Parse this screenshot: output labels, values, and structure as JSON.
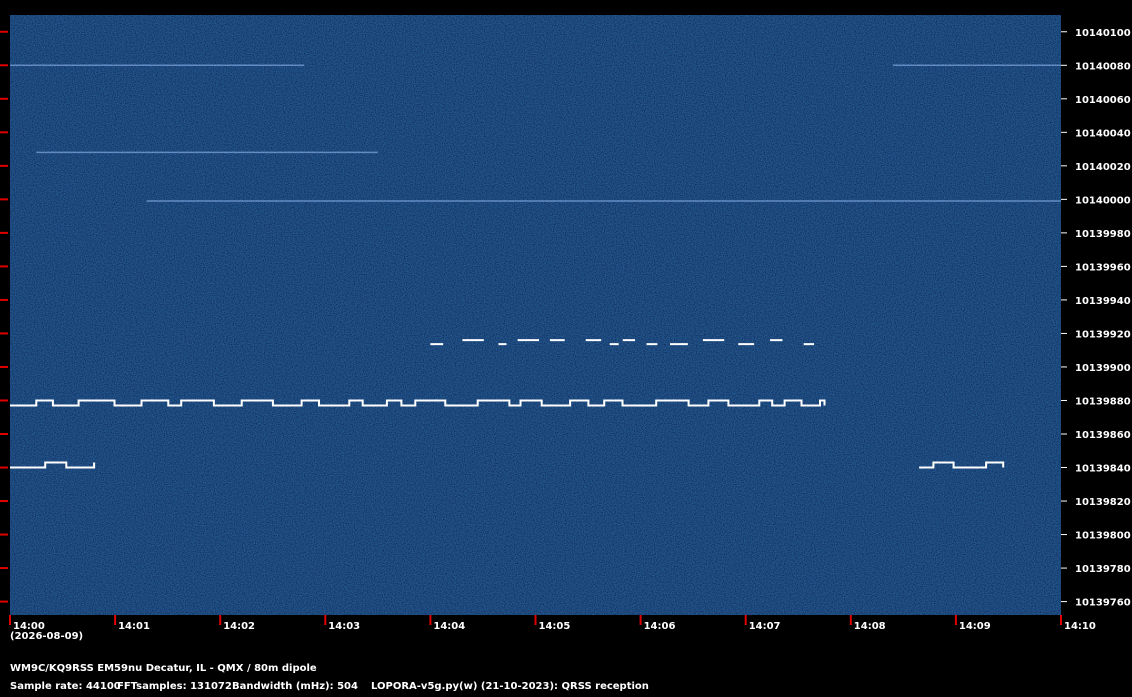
{
  "chart_data": {
    "type": "spectrogram",
    "x_ticks": [
      "14:00",
      "14:01",
      "14:02",
      "14:03",
      "14:04",
      "14:05",
      "14:06",
      "14:07",
      "14:08",
      "14:09",
      "14:10"
    ],
    "y_ticks": [
      10140100,
      10140080,
      10140060,
      10140040,
      10140020,
      10140000,
      10139980,
      10139960,
      10139940,
      10139920,
      10139900,
      10139880,
      10139860,
      10139840,
      10139820,
      10139800,
      10139780,
      10139760
    ],
    "y_range": [
      10139752,
      10140110
    ],
    "x_range_minutes": [
      0,
      10
    ],
    "date": "(2026-08-09)",
    "colors": {
      "background": "#0f2a5e",
      "trace": "#ffffff",
      "tick": "#e00000"
    },
    "signals": [
      {
        "freq_hz": 10139877,
        "start_min": 0.0,
        "end_min": 7.75,
        "style": "fsk",
        "fsk_shift_hz": 3
      },
      {
        "freq_hz": 10139840,
        "start_min": 0.0,
        "end_min": 0.8,
        "style": "fsk",
        "fsk_shift_hz": 3
      },
      {
        "freq_hz": 10139840,
        "start_min": 8.65,
        "end_min": 9.45,
        "style": "fsk",
        "fsk_shift_hz": 3
      },
      {
        "freq_hz": 10139916,
        "start_min": 4.0,
        "end_min": 7.75,
        "style": "dashes"
      },
      {
        "freq_hz": 10140080,
        "start_min": 0.0,
        "end_min": 2.8,
        "style": "faint"
      },
      {
        "freq_hz": 10140080,
        "start_min": 8.4,
        "end_min": 10.0,
        "style": "faint"
      },
      {
        "freq_hz": 10140028,
        "start_min": 0.25,
        "end_min": 3.5,
        "style": "faint"
      },
      {
        "freq_hz": 10139999,
        "start_min": 1.3,
        "end_min": 10.0,
        "style": "faint"
      }
    ]
  },
  "footer": {
    "station": "WM9C/KQ9RSS EM59nu Decatur, IL - QMX / 80m dipole",
    "sample_rate": "Sample rate: 44100",
    "fft_samples": "FFTsamples: 131072",
    "bandwidth": "Bandwidth (mHz): 504",
    "software": "LOPORA-v5g.py(w) (21-10-2023): QRSS reception"
  }
}
